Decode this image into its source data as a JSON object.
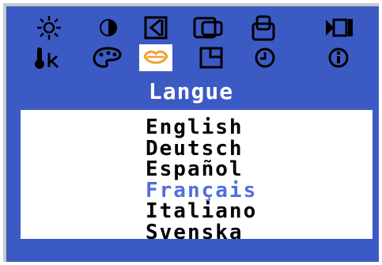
{
  "menu": {
    "title": "Langue",
    "selected_icon": "language-icon",
    "icons_row1": [
      "brightness-icon",
      "contrast-icon",
      "h-position-icon",
      "size-icon",
      "v-position-icon",
      "degauss-icon"
    ],
    "icons_row2": [
      "color-temperature-icon",
      "color-palette-icon",
      "language-icon",
      "geometry-icon",
      "timer-icon",
      "info-icon"
    ]
  },
  "languages": {
    "items": [
      "English",
      "Deutsch",
      "Español",
      "Français",
      "Italiano",
      "Svenska"
    ],
    "active_index": 3
  },
  "colors": {
    "background": "#3c5ac4",
    "text": "#ffffff",
    "highlight": "#4f6fdc",
    "bevel": "#c8c8c8"
  }
}
